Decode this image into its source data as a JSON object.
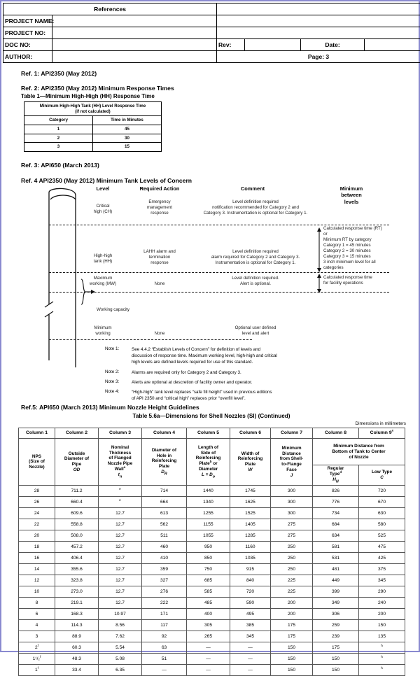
{
  "titleblock": {
    "title": "References",
    "project_name_label": "PROJECT NAME:",
    "project_name_value": "",
    "project_no_label": "PROJECT NO:",
    "project_no_value": "",
    "doc_no_label": "DOC NO:",
    "doc_no_value": "",
    "author_label": "AUTHOR:",
    "author_value": "",
    "rev_label": "Rev:",
    "rev_value": "",
    "date_label": "Date:",
    "date_value": "",
    "page_label": "Page: 3"
  },
  "ref1": {
    "heading": "Ref. 1: API2350 (May 2012)"
  },
  "ref2": {
    "heading": "Ref. 2: API2350 (May 2012) Minimum Response Times",
    "table_caption": "Table 1—Minimum High-High (HH) Response Time",
    "table_title_line1": "Minimum High-High Tank (HH) Level Response Time",
    "table_title_line2": "(if not calculated)",
    "columns": [
      "Category",
      "Time in Minutes"
    ],
    "rows": [
      [
        "1",
        "45"
      ],
      [
        "2",
        "30"
      ],
      [
        "3",
        "15"
      ]
    ]
  },
  "ref3": {
    "heading": "Ref. 3: API650 (March 2013)"
  },
  "ref4": {
    "heading": "Ref. 4 API2350 (May 2012) Minimum Tank Levels of Concern",
    "columns": {
      "level": "Level",
      "required_action": "Required Action",
      "comment": "Comment",
      "minimum_between_levels_l1": "Minimum",
      "minimum_between_levels_l2": "between",
      "minimum_between_levels_l3": "levels"
    },
    "rows": [
      {
        "level_l1": "Critical",
        "level_l2": "high (CH)",
        "action_l1": "Emergency",
        "action_l2": "management",
        "action_l3": "response",
        "comment_l1": "Level definition required",
        "comment_l2": "notification recommended for Category 2 and",
        "comment_l3": "Category 3. Instrumentation is optional for Category 1."
      },
      {
        "level_l1": "High-high",
        "level_l2": "tank (HH)",
        "action_l1": "LAHH alarm and",
        "action_l2": "termination",
        "action_l3": "response",
        "comment_l1": "Level definition required",
        "comment_l2": "alarm required for Category 2 and  Category 3.",
        "comment_l3": "Instrumentation is optional for Category 1."
      },
      {
        "level_l1": "Maximum",
        "level_l2": "working (MW)",
        "action_l1": "None",
        "comment_l1": "Level definition required.",
        "comment_l2": "Alert is optional."
      },
      {
        "level_l1": "Minimum",
        "level_l2": "working",
        "action_l1": "None",
        "comment_l1": "Optional user defined",
        "comment_l2": "level and alert"
      }
    ],
    "between_block_1": [
      "Calculated response time (RT)",
      "or",
      "Minimum RT by category",
      "Category 1 = 45 minutes",
      "Category 2 = 30 minutes",
      "Category 3 = 15 minutes",
      "3 inch minimum level for all",
      "categories"
    ],
    "between_block_2": [
      "Calculated response time",
      "for facility operations"
    ],
    "working_capacity_label": "Working capacity",
    "notes": [
      {
        "label": "Note 1:",
        "lines": [
          "See 4.4.2 “Establish Levels of Concern” for definition of levels and",
          "discussion of response time. Maximum working level, high-high and critical",
          "high levels are defined levels required for use of this standard."
        ]
      },
      {
        "label": "Note 2:",
        "lines": [
          "Alarms are required only for Category 2 and Category 3."
        ]
      },
      {
        "label": "Note 3:",
        "lines": [
          "Alerts are optional at descretion of facility owner and operator."
        ]
      },
      {
        "label": "Note 4:",
        "lines": [
          "“High-high” tank level replaces “safe fill height” used in previous editions",
          "of API 2350 and “critical high” replaces prior “overfill level”."
        ]
      }
    ]
  },
  "ref5": {
    "heading": "Ref.5: API650 (March 2013) Minimum Nozzle Height Guidelines",
    "table_title": "Table 5.6a—Dimensions for Shell Nozzles (SI) (Continued)",
    "dimensions_note": "Dimensions in millimeters"
  },
  "nozzle_table": {
    "column_numbers": [
      "Column 1",
      "Column 2",
      "Column 3",
      "Column 4",
      "Column 5",
      "Column 6",
      "Column 7",
      "Column 8",
      "Column 9"
    ],
    "column_9_footnote": "c",
    "headers": {
      "col1": [
        "NPS",
        "(Size of",
        "Nozzle)"
      ],
      "col2": [
        "Outside",
        "Diameter of",
        "Pipe"
      ],
      "col2_symbol": "OD",
      "col3": [
        "Nominal",
        "Thickness",
        "of Flanged",
        "Nozzle Pipe",
        "Wall"
      ],
      "col3_footnote": "a",
      "col3_symbol": "t",
      "col3_symbol_sub": "n",
      "col4": [
        "Diameter of",
        "Hole in",
        "Reinforcing",
        "Plate"
      ],
      "col4_symbol": "D",
      "col4_symbol_sub": "R",
      "col5": [
        "Length of",
        "Side of",
        "Reinforcing",
        "Plate"
      ],
      "col5_footnote": "b",
      "col5_tail": " or",
      "col5_extra": "Diameter",
      "col5_symbol": "L = D",
      "col5_symbol_sub": "o",
      "col6": [
        "Width of",
        "Reinforcing",
        "Plate"
      ],
      "col6_symbol": "W",
      "col7": [
        "Minimum",
        "Distance",
        "from Shell-",
        "to-Flange",
        "Face"
      ],
      "col7_symbol": "J",
      "col89_merged": [
        "Minimum Distance from",
        "Bottom of Tank to Center",
        "of Nozzle"
      ],
      "col8_sub": [
        "Regular",
        "Type"
      ],
      "col8_footnote": "d",
      "col8_symbol": "H",
      "col8_symbol_sub": "N",
      "col9_sub": [
        "Low Type"
      ],
      "col9_symbol": "C"
    },
    "rows": [
      {
        "nps": "28",
        "nps_sup": "",
        "od": "711.2",
        "tn": "e",
        "tn_sup": true,
        "dr": "714",
        "l": "1440",
        "w": "1745",
        "j": "300",
        "hn": "826",
        "c": "720",
        "c_sup": false
      },
      {
        "nps": "26",
        "nps_sup": "",
        "od": "660.4",
        "tn": "e",
        "tn_sup": true,
        "dr": "664",
        "l": "1340",
        "w": "1625",
        "j": "300",
        "hn": "776",
        "c": "670",
        "c_sup": false
      },
      {
        "nps": "24",
        "nps_sup": "",
        "od": "609.6",
        "tn": "12.7",
        "tn_sup": false,
        "dr": "613",
        "l": "1255",
        "w": "1525",
        "j": "300",
        "hn": "734",
        "c": "630",
        "c_sup": false
      },
      {
        "nps": "22",
        "nps_sup": "",
        "od": "558.8",
        "tn": "12.7",
        "tn_sup": false,
        "dr": "562",
        "l": "1155",
        "w": "1405",
        "j": "275",
        "hn": "684",
        "c": "580",
        "c_sup": false
      },
      {
        "nps": "20",
        "nps_sup": "",
        "od": "508.0",
        "tn": "12.7",
        "tn_sup": false,
        "dr": "511",
        "l": "1055",
        "w": "1285",
        "j": "275",
        "hn": "634",
        "c": "525",
        "c_sup": false
      },
      {
        "nps": "18",
        "nps_sup": "",
        "od": "457.2",
        "tn": "12.7",
        "tn_sup": false,
        "dr": "460",
        "l": "950",
        "w": "1160",
        "j": "250",
        "hn": "581",
        "c": "475",
        "c_sup": false
      },
      {
        "nps": "16",
        "nps_sup": "",
        "od": "406.4",
        "tn": "12.7",
        "tn_sup": false,
        "dr": "410",
        "l": "850",
        "w": "1035",
        "j": "250",
        "hn": "531",
        "c": "425",
        "c_sup": false
      },
      {
        "nps": "14",
        "nps_sup": "",
        "od": "355.6",
        "tn": "12.7",
        "tn_sup": false,
        "dr": "359",
        "l": "750",
        "w": "915",
        "j": "250",
        "hn": "481",
        "c": "375",
        "c_sup": false
      },
      {
        "nps": "12",
        "nps_sup": "",
        "od": "323.8",
        "tn": "12.7",
        "tn_sup": false,
        "dr": "327",
        "l": "685",
        "w": "840",
        "j": "225",
        "hn": "449",
        "c": "345",
        "c_sup": false
      },
      {
        "nps": "10",
        "nps_sup": "",
        "od": "273.0",
        "tn": "12.7",
        "tn_sup": false,
        "dr": "276",
        "l": "585",
        "w": "720",
        "j": "225",
        "hn": "399",
        "c": "290",
        "c_sup": false
      },
      {
        "nps": "8",
        "nps_sup": "",
        "od": "219.1",
        "tn": "12.7",
        "tn_sup": false,
        "dr": "222",
        "l": "485",
        "w": "590",
        "j": "200",
        "hn": "349",
        "c": "240",
        "c_sup": false
      },
      {
        "nps": "6",
        "nps_sup": "",
        "od": "168.3",
        "tn": "10.97",
        "tn_sup": false,
        "dr": "171",
        "l": "400",
        "w": "495",
        "j": "200",
        "hn": "306",
        "c": "200",
        "c_sup": false
      },
      {
        "nps": "4",
        "nps_sup": "",
        "od": "114.3",
        "tn": "8.56",
        "tn_sup": false,
        "dr": "117",
        "l": "305",
        "w": "385",
        "j": "175",
        "hn": "259",
        "c": "150",
        "c_sup": false
      },
      {
        "nps": "3",
        "nps_sup": "",
        "od": "88.9",
        "tn": "7.62",
        "tn_sup": false,
        "dr": "92",
        "l": "265",
        "w": "345",
        "j": "175",
        "hn": "239",
        "c": "135",
        "c_sup": false
      },
      {
        "nps": "2",
        "nps_sup": "f",
        "od": "60.3",
        "tn": "5.54",
        "tn_sup": false,
        "dr": "63",
        "l": "—",
        "w": "—",
        "j": "150",
        "hn": "175",
        "c": "h",
        "c_sup": true
      },
      {
        "nps": "1¹/₂",
        "nps_sup": "f",
        "od": "48.3",
        "tn": "5.08",
        "tn_sup": false,
        "dr": "51",
        "l": "—",
        "w": "—",
        "j": "150",
        "hn": "150",
        "c": "h",
        "c_sup": true
      },
      {
        "nps": "1",
        "nps_sup": "f",
        "od": "33.4",
        "tn": "6.35",
        "tn_sup": false,
        "dr": "—",
        "l": "—",
        "w": "—",
        "j": "150",
        "hn": "150",
        "c": "h",
        "c_sup": true
      }
    ]
  }
}
